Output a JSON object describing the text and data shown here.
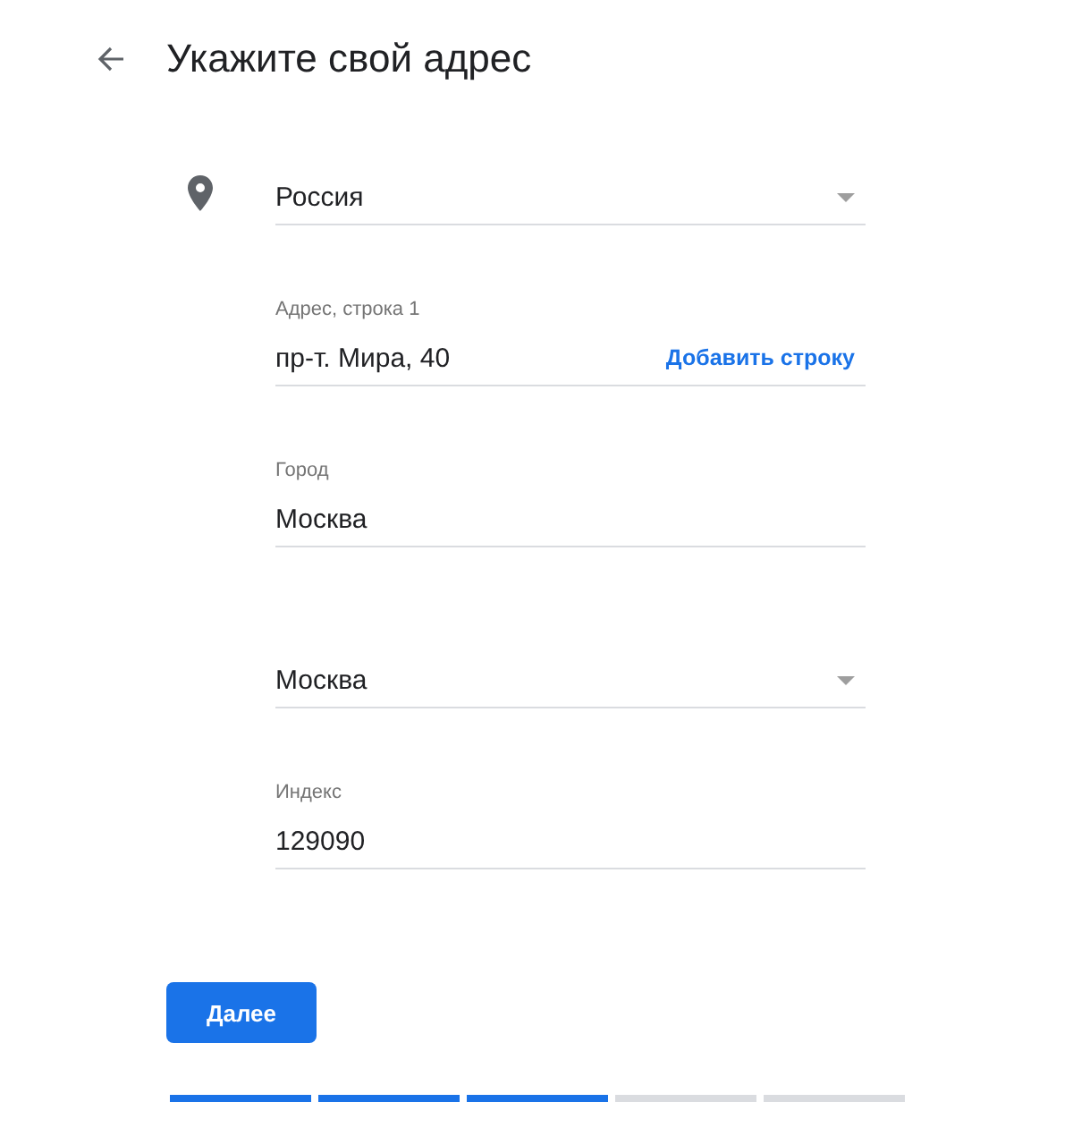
{
  "header": {
    "title": "Укажите свой адрес"
  },
  "fields": [
    {
      "kind": "select",
      "value": "Россия"
    },
    {
      "kind": "text",
      "label": "Адрес, строка 1",
      "value": "пр-т. Мира, 40",
      "action": "Добавить строку"
    },
    {
      "kind": "text",
      "label": "Город",
      "value": "Москва"
    },
    {
      "kind": "select",
      "value": "Москва"
    },
    {
      "kind": "text",
      "label": "Индекс",
      "value": "129090"
    }
  ],
  "button": "Далее",
  "progress": [
    {
      "completed": true
    },
    {
      "completed": true
    },
    {
      "completed": true
    },
    {
      "completed": false
    },
    {
      "completed": false
    }
  ]
}
